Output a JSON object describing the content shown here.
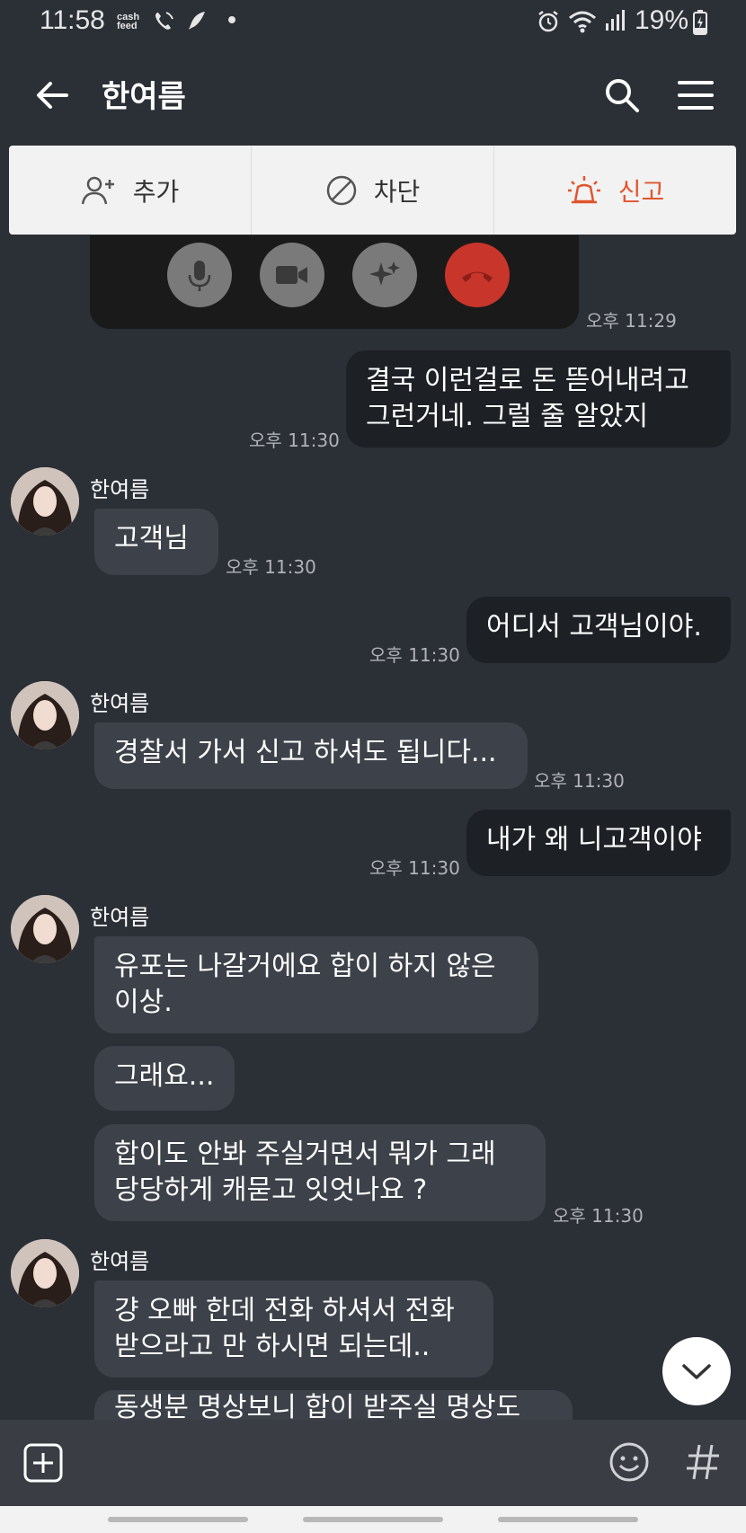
{
  "status_bar": {
    "time": "11:58",
    "cash_label": "cash feed",
    "battery": "19%"
  },
  "header": {
    "title": "한여름"
  },
  "actions": {
    "add": "추가",
    "block": "차단",
    "report": "신고"
  },
  "messages": [
    {
      "type": "time",
      "text": "오후 11:29"
    },
    {
      "type": "out",
      "text_lines": [
        "결국 이런걸로 돈 뜯어내려고",
        "그런거네. 그럴 줄 알았지"
      ],
      "time": "오후 11:30"
    },
    {
      "type": "in",
      "sender": "한여름",
      "text": "고객님",
      "time": "오후 11:30"
    },
    {
      "type": "out",
      "text": "어디서 고객님이야.",
      "time": "오후 11:30"
    },
    {
      "type": "in",
      "sender": "한여름",
      "text": "경찰서 가서 신고 하셔도 됩니다...",
      "time": "오후 11:30"
    },
    {
      "type": "out",
      "text": "내가 왜 니고객이야",
      "time": "오후 11:30"
    },
    {
      "type": "in",
      "sender": "한여름",
      "text_lines": [
        "유포는 나갈거에요 합이 하지 않은",
        "이상."
      ]
    },
    {
      "type": "in",
      "text": "그래요..."
    },
    {
      "type": "in",
      "text_lines": [
        "합이도 안봐 주실거면서  뭐가 그래",
        "당당하게  캐묻고 잇엇나요 ?"
      ],
      "time": "오후 11:30"
    },
    {
      "type": "in",
      "sender": "한여름",
      "text_lines": [
        "걍 오빠 한데 전화 하셔서 전화",
        "받으라고 만 하시면 되는데.."
      ]
    },
    {
      "type": "in",
      "text": "동생분 명상보니  합이 받주실 명상도"
    }
  ],
  "icons": {
    "back": "arrow-left-icon",
    "search": "search-icon",
    "menu": "hamburger-menu-icon",
    "add_friend": "person-plus-icon",
    "block": "block-icon",
    "report": "siren-icon",
    "mic": "microphone-icon",
    "camera": "video-camera-icon",
    "effects": "sparkle-icon",
    "hangup": "hang-up-icon",
    "scroll_down": "chevron-down-icon",
    "attach": "plus-box-icon",
    "emoji": "emoji-icon",
    "hashtag": "hashtag-icon"
  },
  "colors": {
    "background": "#2b2f36",
    "incoming_bubble": "#3d4149",
    "outgoing_bubble": "#1d2025",
    "report_accent": "#e0552f"
  }
}
